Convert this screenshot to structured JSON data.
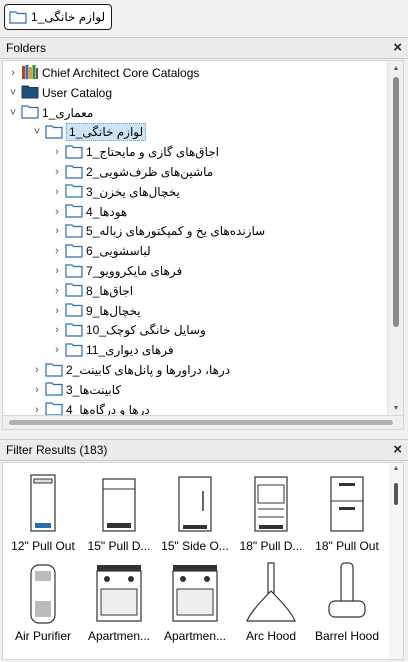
{
  "breadcrumb": {
    "label": "لوازم خانگی_1",
    "icon": "folder-icon"
  },
  "folders_panel": {
    "title": "Folders",
    "close_label": "×",
    "tree": [
      {
        "label": "Chief Architect Core Catalogs",
        "icon": "books-icon",
        "chevron": "›",
        "level": 0
      },
      {
        "label": "User Catalog",
        "icon": "dark-folder-icon",
        "chevron": "˅",
        "level": 0
      },
      {
        "label": "معماری_1",
        "icon": "folder-icon",
        "chevron": "˅",
        "level": 1
      },
      {
        "label": "لوازم خانگی_1",
        "icon": "folder-icon",
        "chevron": "˅",
        "level": 2,
        "selected": true
      },
      {
        "label": "اجاق‌های گازی و مایحتاج_1",
        "icon": "folder-icon",
        "chevron": "›",
        "level": 3
      },
      {
        "label": "ماشین‌های ظرف‌شویی_2",
        "icon": "folder-icon",
        "chevron": "›",
        "level": 3
      },
      {
        "label": "یخچال‌های یخزن_3",
        "icon": "folder-icon",
        "chevron": "›",
        "level": 3
      },
      {
        "label": "هودها_4",
        "icon": "folder-icon",
        "chevron": "›",
        "level": 3
      },
      {
        "label": "سازنده‌های یخ و کمپکتورهای زباله_5",
        "icon": "folder-icon",
        "chevron": "›",
        "level": 3
      },
      {
        "label": "لباسشویی_6",
        "icon": "folder-icon",
        "chevron": "›",
        "level": 3
      },
      {
        "label": "فرهای مایکروویو_7",
        "icon": "folder-icon",
        "chevron": "›",
        "level": 3
      },
      {
        "label": "اجاق‌ها_8",
        "icon": "folder-icon",
        "chevron": "›",
        "level": 3
      },
      {
        "label": "یخچال‌ها_9",
        "icon": "folder-icon",
        "chevron": "›",
        "level": 3
      },
      {
        "label": "وسایل خانگی کوچک_10",
        "icon": "folder-icon",
        "chevron": "›",
        "level": 3
      },
      {
        "label": "فرهای دیواری_11",
        "icon": "folder-icon",
        "chevron": "›",
        "level": 3
      },
      {
        "label": "درها، دراورها و پانل‌های کابینت_2",
        "icon": "folder-icon",
        "chevron": "›",
        "level": 2
      },
      {
        "label": "کابینت‌ها_3",
        "icon": "folder-icon",
        "chevron": "›",
        "level": 2
      },
      {
        "label": "درها و درگاه‌ها_4",
        "icon": "folder-icon",
        "chevron": "›",
        "level": 2
      }
    ]
  },
  "results_panel": {
    "title": "Filter Results (183)",
    "close_label": "×",
    "items": [
      {
        "label": "12\" Pull Out",
        "icon": "tall-narrow-appliance-icon"
      },
      {
        "label": "15\" Pull D...",
        "icon": "mini-fridge-icon"
      },
      {
        "label": "15\" Side O...",
        "icon": "side-open-fridge-icon"
      },
      {
        "label": "18\" Pull D...",
        "icon": "drawer-fridge-icon"
      },
      {
        "label": "18\" Pull Out",
        "icon": "pull-out-fridge-icon"
      },
      {
        "label": "Air Purifier",
        "icon": "air-purifier-icon"
      },
      {
        "label": "Apartmen...",
        "icon": "stove-icon"
      },
      {
        "label": "Apartmen...",
        "icon": "stove-icon"
      },
      {
        "label": "Arc Hood",
        "icon": "arc-hood-icon"
      },
      {
        "label": "Barrel Hood",
        "icon": "barrel-hood-icon"
      }
    ]
  },
  "colors": {
    "selection": "#cce4f7",
    "folder_fill": "#ffffff",
    "folder_stroke": "#2a6db0",
    "dark_folder": "#1f4e79"
  }
}
